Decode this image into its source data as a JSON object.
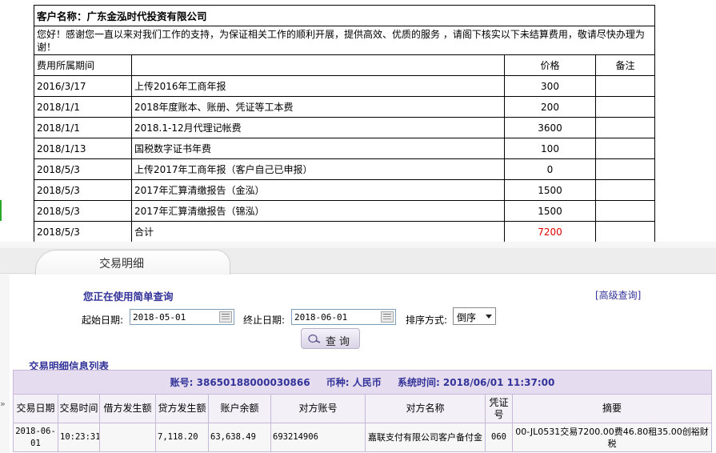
{
  "statement": {
    "customer_label": "客户名称：广东金泓时代投资有限公司",
    "greeting": "您好！感谢您一直以来对我们工作的支持，为保证相关工作的顺利开展，提供高效、优质的服务 ，请阁下核实以下未结算费用，敬请尽快办理为谢！",
    "columns": [
      "费用所属期间",
      "",
      "价格",
      "备注"
    ],
    "rows": [
      {
        "date": "2016/3/17",
        "item": "上传2016年工商年报",
        "price": "300",
        "note": ""
      },
      {
        "date": "2018/1/1",
        "item": "2018年度账本、账册、凭证等工本费",
        "price": "200",
        "note": ""
      },
      {
        "date": "2018/1/1",
        "item": "2018.1-12月代理记帐费",
        "price": "3600",
        "note": ""
      },
      {
        "date": "2018/1/13",
        "item": "国税数字证书年费",
        "price": "100",
        "note": ""
      },
      {
        "date": "2018/5/3",
        "item": "上传2017年工商年报（客户自己已申报）",
        "price": "0",
        "note": ""
      },
      {
        "date": "2018/5/3",
        "item": "2017年汇算清缴报告（金泓）",
        "price": "1500",
        "note": ""
      },
      {
        "date": "2018/5/3",
        "item": "2017年汇算清缴报告（锦泓）",
        "price": "1500",
        "note": ""
      }
    ],
    "total": {
      "date": "2018/5/3",
      "item": "合计",
      "price": "7200",
      "note": ""
    },
    "total_color": "#e00000"
  },
  "panel": {
    "tab_label": "交易明细",
    "mode_title": "您正在使用简单查询",
    "advanced_link": "[高级查询]",
    "start_label": "起始日期:",
    "start_value": "2018-05-01",
    "end_label": "终止日期:",
    "end_value": "2018-06-01",
    "sort_label": "排序方式:",
    "sort_value": "倒序",
    "query_button": "查询",
    "list_title": "交易明细信息列表",
    "accent_color": "#333399"
  },
  "transactions": {
    "account": "账号: 38650188000030866",
    "currency": "币种: 人民币",
    "system_time": "系统时间: 2018/06/01 11:37:00",
    "columns": [
      "交易日期",
      "交易时间",
      "借方发生额",
      "贷方发生额",
      "账户余额",
      "对方账号",
      "对方名称",
      "凭证号",
      "摘要"
    ],
    "rows": [
      {
        "date": "2018-06-01",
        "time": "10:23:31",
        "debit": "",
        "credit": "7,118.20",
        "balance": "63,638.49",
        "counter_account": "693214906",
        "counter_name": "嘉联支付有限公司客户备付金",
        "voucher": "060",
        "summary": "00-JL0531交易7200.00费46.80租35.00创裕财税"
      }
    ]
  },
  "misc": {
    "collapse_mark": "»"
  }
}
